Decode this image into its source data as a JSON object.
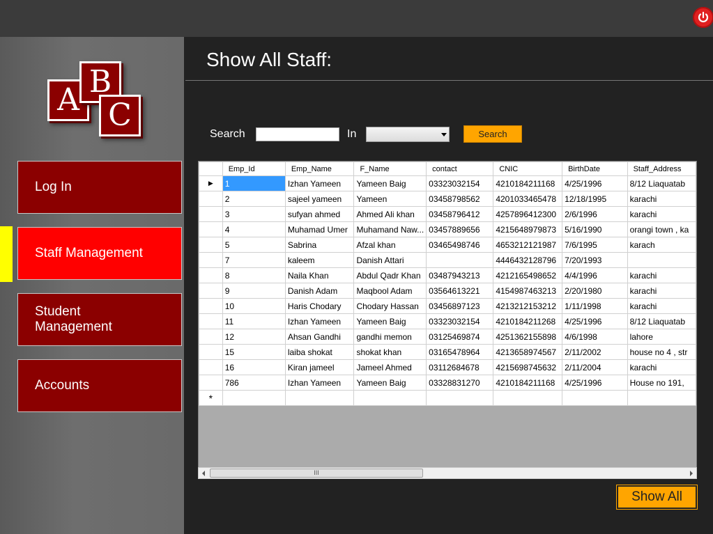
{
  "window": {
    "power_icon": "power-icon"
  },
  "logo": {
    "letters": [
      "A",
      "B",
      "C"
    ]
  },
  "sidebar": {
    "items": [
      {
        "label": "Log In"
      },
      {
        "label": "Staff Management"
      },
      {
        "label": "Student Management"
      },
      {
        "label": "Accounts"
      }
    ],
    "active_item": "Staff Management",
    "colors": {
      "item": "#8b0000",
      "active": "#ff0000",
      "marker": "#ffff00"
    }
  },
  "main": {
    "title": "Show All Staff:",
    "search": {
      "label": "Search",
      "value": "",
      "in_label": "In",
      "selected_field": "",
      "button_label": "Search"
    },
    "show_all_label": "Show All",
    "accent": "#ffa500"
  },
  "grid": {
    "columns": [
      "Emp_Id",
      "Emp_Name",
      "F_Name",
      "contact",
      "CNIC",
      "BirthDate",
      "Staff_Address"
    ],
    "rows": [
      [
        "1",
        "Izhan Yameen",
        "Yameen Baig",
        "03323032154",
        "4210184211168",
        "4/25/1996",
        "8/12 Liaquatab"
      ],
      [
        "2",
        "sajeel yameen",
        "Yameen",
        "03458798562",
        "4201033465478",
        "12/18/1995",
        "karachi"
      ],
      [
        "3",
        "sufyan ahmed",
        "Ahmed Ali khan",
        "03458796412",
        "4257896412300",
        "2/6/1996",
        "karachi"
      ],
      [
        "4",
        "Muhamad Umer",
        "Muhamand Naw...",
        "03457889656",
        "4215648979873",
        "5/16/1990",
        "orangi town , ka"
      ],
      [
        "5",
        "Sabrina",
        "Afzal khan",
        "03465498746",
        "4653212121987",
        "7/6/1995",
        "karach"
      ],
      [
        "7",
        "kaleem",
        "Danish Attari",
        "",
        "4446432128796",
        "7/20/1993",
        ""
      ],
      [
        "8",
        "Naila Khan",
        "Abdul Qadr Khan",
        "03487943213",
        "4212165498652",
        "4/4/1996",
        "karachi"
      ],
      [
        "9",
        "Danish Adam",
        "Maqbool Adam",
        "03564613221",
        "4154987463213",
        "2/20/1980",
        "karachi"
      ],
      [
        "10",
        "Haris Chodary",
        "Chodary Hassan",
        "03456897123",
        "4213212153212",
        "1/11/1998",
        "karachi"
      ],
      [
        "11",
        "Izhan Yameen",
        "Yameen Baig",
        "03323032154",
        "4210184211268",
        "4/25/1996",
        "8/12 Liaquatab"
      ],
      [
        "12",
        "Ahsan Gandhi",
        "gandhi memon",
        "03125469874",
        "4251362155898",
        "4/6/1998",
        "lahore"
      ],
      [
        "15",
        "laiba shokat",
        "shokat khan",
        "03165478964",
        "4213658974567",
        "2/11/2002",
        "house no 4 , str"
      ],
      [
        "16",
        "Kiran jameel",
        "Jameel Ahmed",
        "03112684678",
        "4215698745632",
        "2/11/2004",
        "karachi"
      ],
      [
        "786",
        "Izhan Yameen",
        "Yameen Baig",
        "03328831270",
        "4210184211168",
        "4/25/1996",
        "House no 191,"
      ]
    ],
    "current_row_marker": "▶",
    "new_row_marker": "*",
    "scroll_thumb_label": "III"
  }
}
